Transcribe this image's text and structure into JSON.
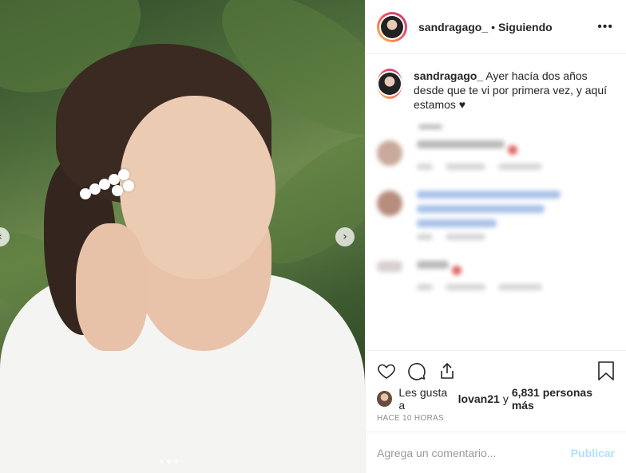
{
  "header": {
    "username": "sandragago_",
    "separator": "•",
    "follow_status": "Siguiendo",
    "more_icon": "more-horizontal-icon"
  },
  "caption": {
    "username": "sandragago_",
    "text": "Ayer hacía dos años desde que te vi por primera vez, y aquí estamos ♥"
  },
  "photo": {
    "prev_icon": "‹",
    "next_icon": "›"
  },
  "actions": {
    "like_icon": "heart-icon",
    "comment_icon": "comment-icon",
    "share_icon": "share-icon",
    "save_icon": "bookmark-icon"
  },
  "likes": {
    "prefix": "Les gusta a ",
    "user": "lovan21",
    "middle": " y ",
    "count": "6,831 personas más"
  },
  "timestamp": "HACE 10 HORAS",
  "comment_box": {
    "placeholder": "Agrega un comentario...",
    "publish_label": "Publicar"
  },
  "colors": {
    "accent_blue": "#b2dffc",
    "text": "#262626",
    "muted": "#8e8e8e"
  }
}
